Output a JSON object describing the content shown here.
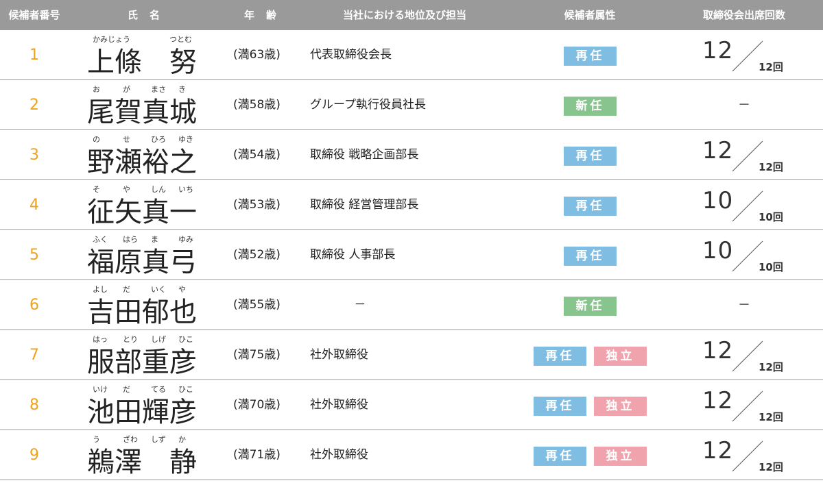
{
  "header": {
    "candidate_no": "候補者番号",
    "name": "氏　名",
    "age": "年　齢",
    "position": "当社における地位及び担当",
    "attribute": "候補者属性",
    "attendance": "取締役会出席回数"
  },
  "colors": {
    "reappoint": "#7fbde3",
    "new": "#88c48e",
    "independent": "#f0a3ac",
    "number": "#f0a21b",
    "header_bg": "#9a9a9a"
  },
  "rows": [
    {
      "num": "1",
      "name": "上條　努",
      "furigana": [
        "かみじょう",
        "つとむ"
      ],
      "age": "(満63歳)",
      "position": "代表取締役会長",
      "badges": [
        "再任"
      ],
      "att_count": "12",
      "att_total": "12回"
    },
    {
      "num": "2",
      "name": "尾賀真城",
      "furigana": [
        "お",
        "が",
        "まさ",
        "き"
      ],
      "age": "(満58歳)",
      "position": "グループ執行役員社長",
      "badges": [
        "新任"
      ],
      "att_dash": "－"
    },
    {
      "num": "3",
      "name": "野瀬裕之",
      "furigana": [
        "の",
        "せ",
        "ひろ",
        "ゆき"
      ],
      "age": "(満54歳)",
      "position": "取締役 戦略企画部長",
      "badges": [
        "再任"
      ],
      "att_count": "12",
      "att_total": "12回"
    },
    {
      "num": "4",
      "name": "征矢真一",
      "furigana": [
        "そ",
        "や",
        "しん",
        "いち"
      ],
      "age": "(満53歳)",
      "position": "取締役 経営管理部長",
      "badges": [
        "再任"
      ],
      "att_count": "10",
      "att_total": "10回"
    },
    {
      "num": "5",
      "name": "福原真弓",
      "furigana": [
        "ふく",
        "はら",
        "ま",
        "ゆみ"
      ],
      "age": "(満52歳)",
      "position": "取締役 人事部長",
      "badges": [
        "再任"
      ],
      "att_count": "10",
      "att_total": "10回"
    },
    {
      "num": "6",
      "name": "吉田郁也",
      "furigana": [
        "よし",
        "だ",
        "いく",
        "や"
      ],
      "age": "(満55歳)",
      "position": "－",
      "badges": [
        "新任"
      ],
      "att_dash": "－"
    },
    {
      "num": "7",
      "name": "服部重彦",
      "furigana": [
        "はっ",
        "とり",
        "しげ",
        "ひこ"
      ],
      "age": "(満75歳)",
      "position": "社外取締役",
      "badges": [
        "再任",
        "独立"
      ],
      "att_count": "12",
      "att_total": "12回"
    },
    {
      "num": "8",
      "name": "池田輝彦",
      "furigana": [
        "いけ",
        "だ",
        "てる",
        "ひこ"
      ],
      "age": "(満70歳)",
      "position": "社外取締役",
      "badges": [
        "再任",
        "独立"
      ],
      "att_count": "12",
      "att_total": "12回"
    },
    {
      "num": "9",
      "name": "鵜澤　静",
      "furigana": [
        "う",
        "ざわ",
        "しず",
        "か"
      ],
      "age": "(満71歳)",
      "position": "社外取締役",
      "badges": [
        "再任",
        "独立"
      ],
      "att_count": "12",
      "att_total": "12回"
    }
  ]
}
